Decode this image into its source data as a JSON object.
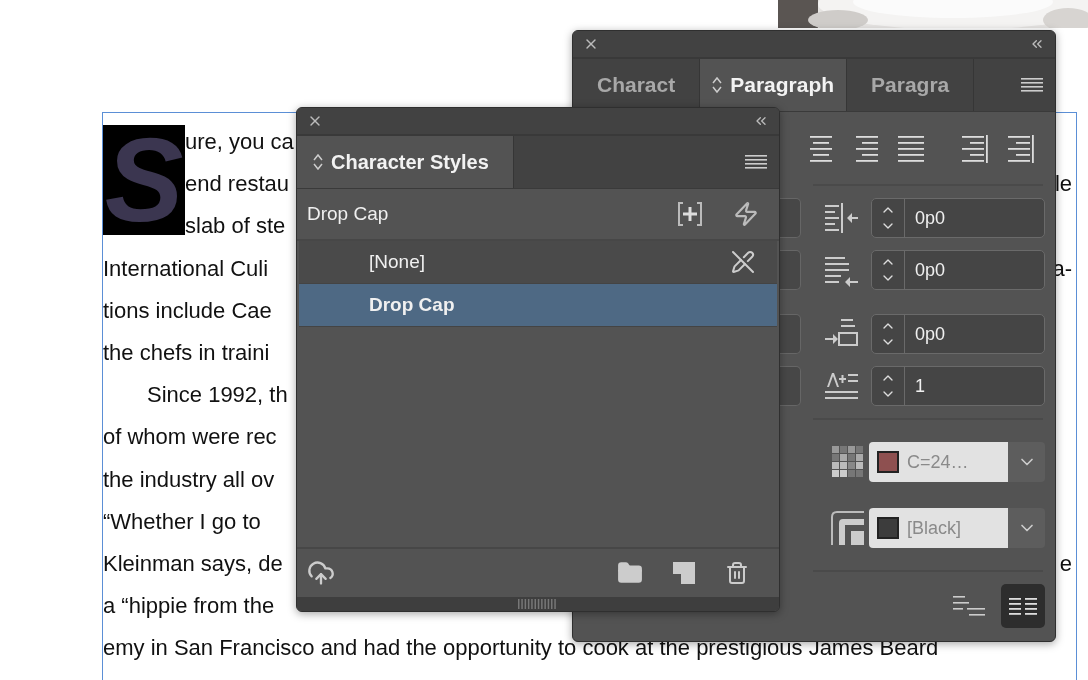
{
  "document": {
    "drop_cap": "S",
    "lines": [
      {
        "text": "ure, you ca",
        "indent": false
      },
      {
        "text": "end restau",
        "indent": false,
        "right": "le"
      },
      {
        "text": "slab of ste",
        "indent": false
      },
      {
        "text": "International Culi",
        "indent": false,
        "right": "a-"
      },
      {
        "text": "tions include Cae",
        "indent": false
      },
      {
        "text": "the chefs in traini",
        "indent": false
      },
      {
        "text": "Since 1992, th",
        "indent": true
      },
      {
        "text": "of whom were rec",
        "indent": false
      },
      {
        "text": "the industry all ov",
        "indent": false
      },
      {
        "text": "“Whether I go to",
        "indent": false
      },
      {
        "text": "Kleinman says, de",
        "indent": false,
        "right": "e"
      },
      {
        "text": "a “hippie from the",
        "indent": false
      },
      {
        "text": "emy in San Francisco and had the opportunity to cook at the prestigious James Beard",
        "indent": false
      }
    ]
  },
  "paragraph_panel": {
    "tabs": [
      {
        "label": "Charact",
        "selected": false
      },
      {
        "label": "Paragraph",
        "selected": true
      },
      {
        "label": "Paragra",
        "selected": false
      }
    ],
    "fields": [
      "0p0",
      "0p0",
      "0p0",
      "1"
    ],
    "shading": {
      "color": "#8e5050",
      "value": "C=24…"
    },
    "border": {
      "color": "#3c3c3c",
      "value": "[Black]"
    },
    "layout_buttons": [
      {
        "kind": "single",
        "selected": false
      },
      {
        "kind": "columns",
        "selected": true
      }
    ]
  },
  "character_styles_panel": {
    "tab": {
      "label": "Character Styles",
      "selected": true
    },
    "group_label": "Drop Cap",
    "styles": [
      {
        "name": "[None]",
        "selected": false
      },
      {
        "name": "Drop Cap",
        "selected": true
      }
    ]
  }
}
